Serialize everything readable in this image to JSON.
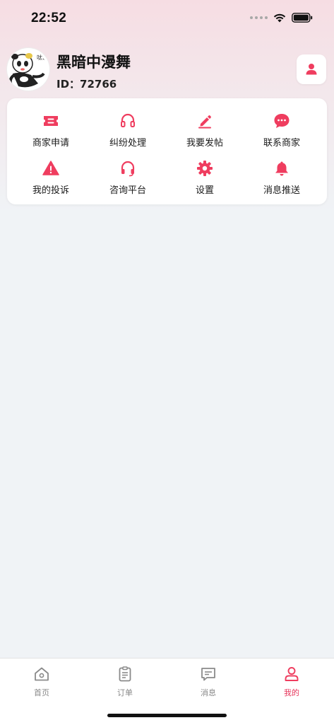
{
  "colors": {
    "accent": "#ef3d5f",
    "inactive": "#8a8a8a"
  },
  "status_bar": {
    "time": "22:52"
  },
  "profile": {
    "avatar_text": "呔、",
    "name": "黑暗中漫舞",
    "id_label": "ID：",
    "id_value": "72766"
  },
  "menu": {
    "items": [
      {
        "label": "商家申请",
        "icon": "ticket-icon"
      },
      {
        "label": "纠纷处理",
        "icon": "headset-icon"
      },
      {
        "label": "我要发帖",
        "icon": "pen-icon"
      },
      {
        "label": "联系商家",
        "icon": "chat-bubble-icon"
      },
      {
        "label": "我的投诉",
        "icon": "warning-icon"
      },
      {
        "label": "咨询平台",
        "icon": "headset-icon"
      },
      {
        "label": "设置",
        "icon": "gear-icon"
      },
      {
        "label": "消息推送",
        "icon": "bell-icon"
      }
    ]
  },
  "bottom_nav": {
    "items": [
      {
        "label": "首页",
        "icon": "home-icon",
        "active": false
      },
      {
        "label": "订单",
        "icon": "clipboard-icon",
        "active": false
      },
      {
        "label": "消息",
        "icon": "message-icon",
        "active": false
      },
      {
        "label": "我的",
        "icon": "user-icon",
        "active": true
      }
    ]
  }
}
